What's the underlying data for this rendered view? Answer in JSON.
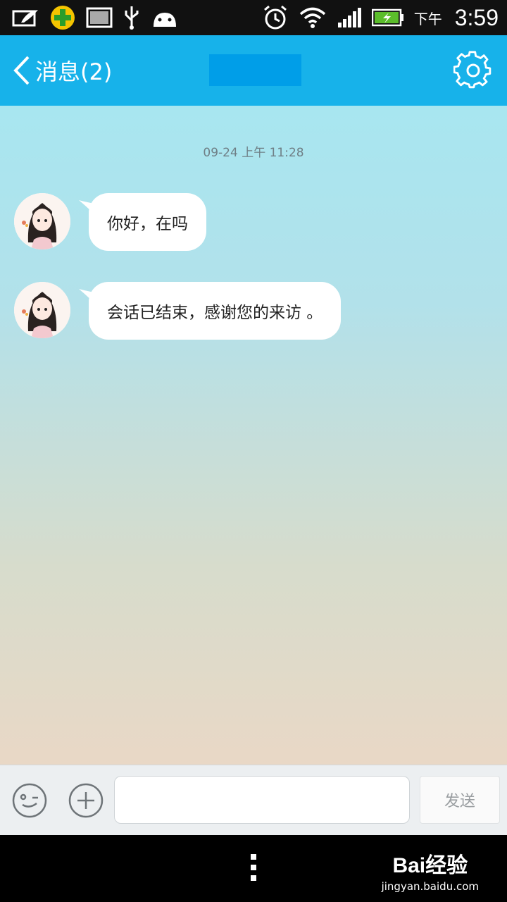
{
  "status_bar": {
    "ampm": "下午",
    "time": "3:59",
    "icons_left": [
      "notebook-icon",
      "plus-shield-icon",
      "image-icon",
      "usb-icon",
      "android-icon"
    ],
    "icons_right": [
      "alarm-icon",
      "wifi-icon",
      "signal-icon",
      "battery-icon"
    ]
  },
  "header": {
    "back_label": "消息(2)",
    "accent_color": "#17b2ea"
  },
  "chat": {
    "timestamp": "09-24 上午 11:28",
    "messages": [
      {
        "text": "你好，在吗"
      },
      {
        "text": "会话已结束，感谢您的来访 。"
      }
    ]
  },
  "input_bar": {
    "placeholder": "",
    "send_label": "发送"
  },
  "watermark": {
    "logo_text": "Bai经验",
    "url": "jingyan.baidu.com"
  }
}
